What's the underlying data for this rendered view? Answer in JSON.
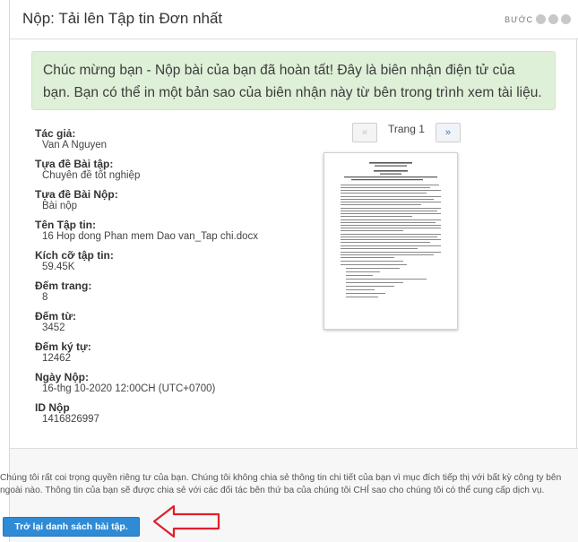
{
  "header": {
    "title": "Nộp: Tải lên Tập tin Đơn nhất",
    "step_label": "BƯỚC"
  },
  "banner": {
    "text": "Chúc mừng bạn - Nộp bài của bạn đã hoàn tất! Đây là biên nhận điện tử của bạn. Bạn có thể in một bản sao của biên nhận này từ bên trong trình xem tài liệu."
  },
  "details": [
    {
      "label": "Tác giả:",
      "value": "Van A Nguyen"
    },
    {
      "label": "Tựa đề Bài tập:",
      "value": "Chuyên đề tốt nghiệp"
    },
    {
      "label": "Tựa đề Bài Nộp:",
      "value": "Bài nộp"
    },
    {
      "label": "Tên Tập tin:",
      "value": "16 Hop dong Phan mem Dao van_Tap chi.docx"
    },
    {
      "label": "Kích cỡ tập tin:",
      "value": "59.45K"
    },
    {
      "label": "Đếm trang:",
      "value": "8"
    },
    {
      "label": "Đếm từ:",
      "value": "3452"
    },
    {
      "label": "Đếm ký tự:",
      "value": "12462"
    },
    {
      "label": "Ngày Nộp:",
      "value": "16-thg 10-2020 12:00CH (UTC+0700)"
    },
    {
      "label": "ID Nộp",
      "value": "1416826997"
    }
  ],
  "viewer": {
    "prev_icon": "«",
    "next_icon": "»",
    "page_label": "Trang 1"
  },
  "footer": {
    "privacy_text": "Chúng tôi rất coi trọng quyền riêng tư của bạn. Chúng tôi không chia sẻ thông tin chi tiết của bạn vì mục đích tiếp thị với bất kỳ công ty bên ngoài nào. Thông tin của bạn sẽ được chia sẻ với các đối tác bên thứ ba của chúng tôi CHỈ sao cho chúng tôi có thể cung cấp dịch vụ.",
    "back_button": "Trở lại danh sách bài tập."
  },
  "colors": {
    "banner_bg": "#dff0d8",
    "button_bg": "#2f8bd6",
    "arrow": "#e0202a"
  }
}
